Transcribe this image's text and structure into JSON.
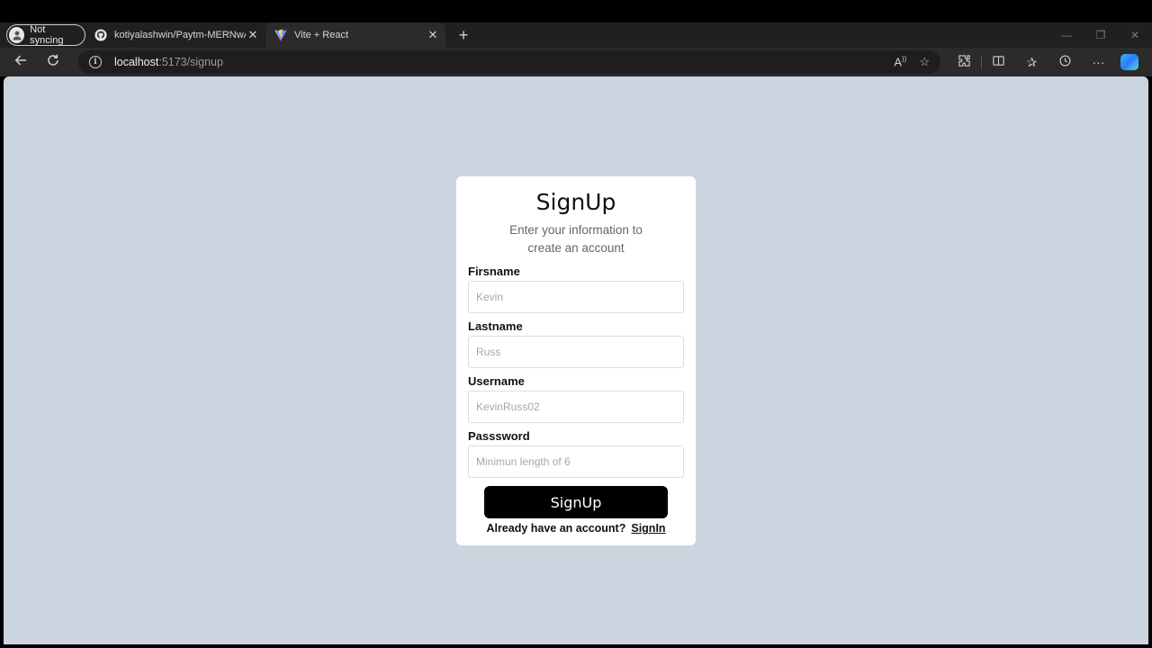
{
  "browser": {
    "profile_label": "Not syncing",
    "tabs": [
      {
        "title": "kotiyalashwin/Paytm-MERNwAuth",
        "icon": "github-icon"
      },
      {
        "title": "Vite + React",
        "icon": "vite-icon"
      }
    ],
    "address": {
      "host": "localhost",
      "path": ":5173/signup"
    }
  },
  "form": {
    "title": "SignUp",
    "subtitle": "Enter your information to create an account",
    "fields": [
      {
        "label": "Firsname",
        "placeholder": "Kevin"
      },
      {
        "label": "Lastname",
        "placeholder": "Russ"
      },
      {
        "label": "Username",
        "placeholder": "KevinRuss02"
      },
      {
        "label": "Passsword",
        "placeholder": "Minimun length of 6"
      }
    ],
    "submit_label": "SignUp",
    "footer_text": "Already have an account?",
    "footer_link": "SignIn"
  },
  "colors": {
    "page_background": "#cbd5e0",
    "card_background": "#ffffff",
    "button_background": "#000000"
  }
}
